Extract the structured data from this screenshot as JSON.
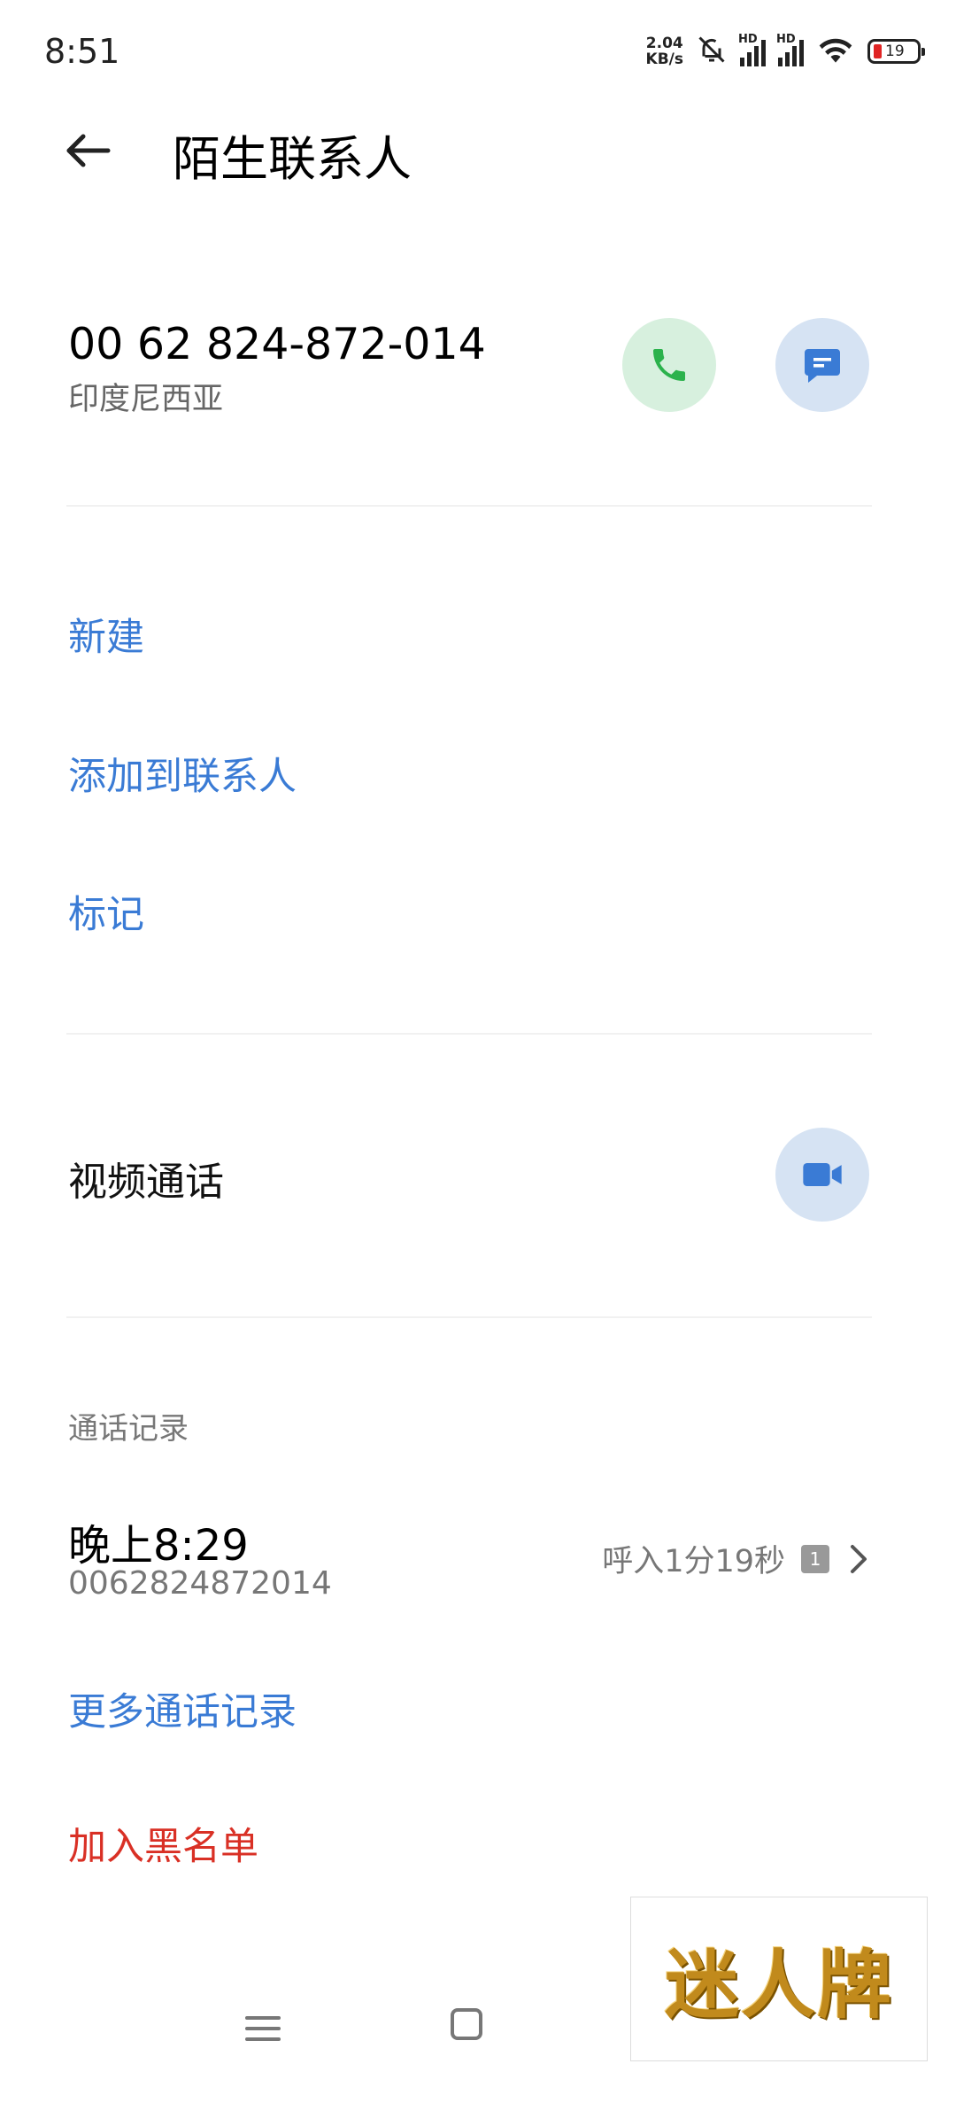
{
  "status_bar": {
    "time": "8:51",
    "net_speed_value": "2.04",
    "net_speed_unit": "KB/s",
    "hd1": "HD",
    "hd2": "HD",
    "battery_level": "19",
    "battery_color": "#e02424"
  },
  "header": {
    "title": "陌生联系人",
    "back_icon": "arrow-left-icon"
  },
  "contact": {
    "number": "00 62 824-872-014",
    "region": "印度尼西亚",
    "call_icon": "phone-icon",
    "message_icon": "message-icon",
    "call_color": "#2bb24c",
    "message_color": "#3a7bd5"
  },
  "actions": {
    "new": "新建",
    "add_to_contacts": "添加到联系人",
    "mark": "标记"
  },
  "video_call": {
    "label": "视频通话",
    "icon": "video-camera-icon"
  },
  "call_log": {
    "section_label": "通话记录",
    "entries": [
      {
        "time": "晚上8:29",
        "number": "0062824872014",
        "description": "呼入1分19秒",
        "sim": "1"
      }
    ],
    "more_label": "更多通话记录"
  },
  "blacklist_label": "加入黑名单",
  "nav_bar": {
    "menu_icon": "menu-icon",
    "home_icon": "home-icon"
  },
  "watermark": {
    "text": "迷人牌"
  }
}
